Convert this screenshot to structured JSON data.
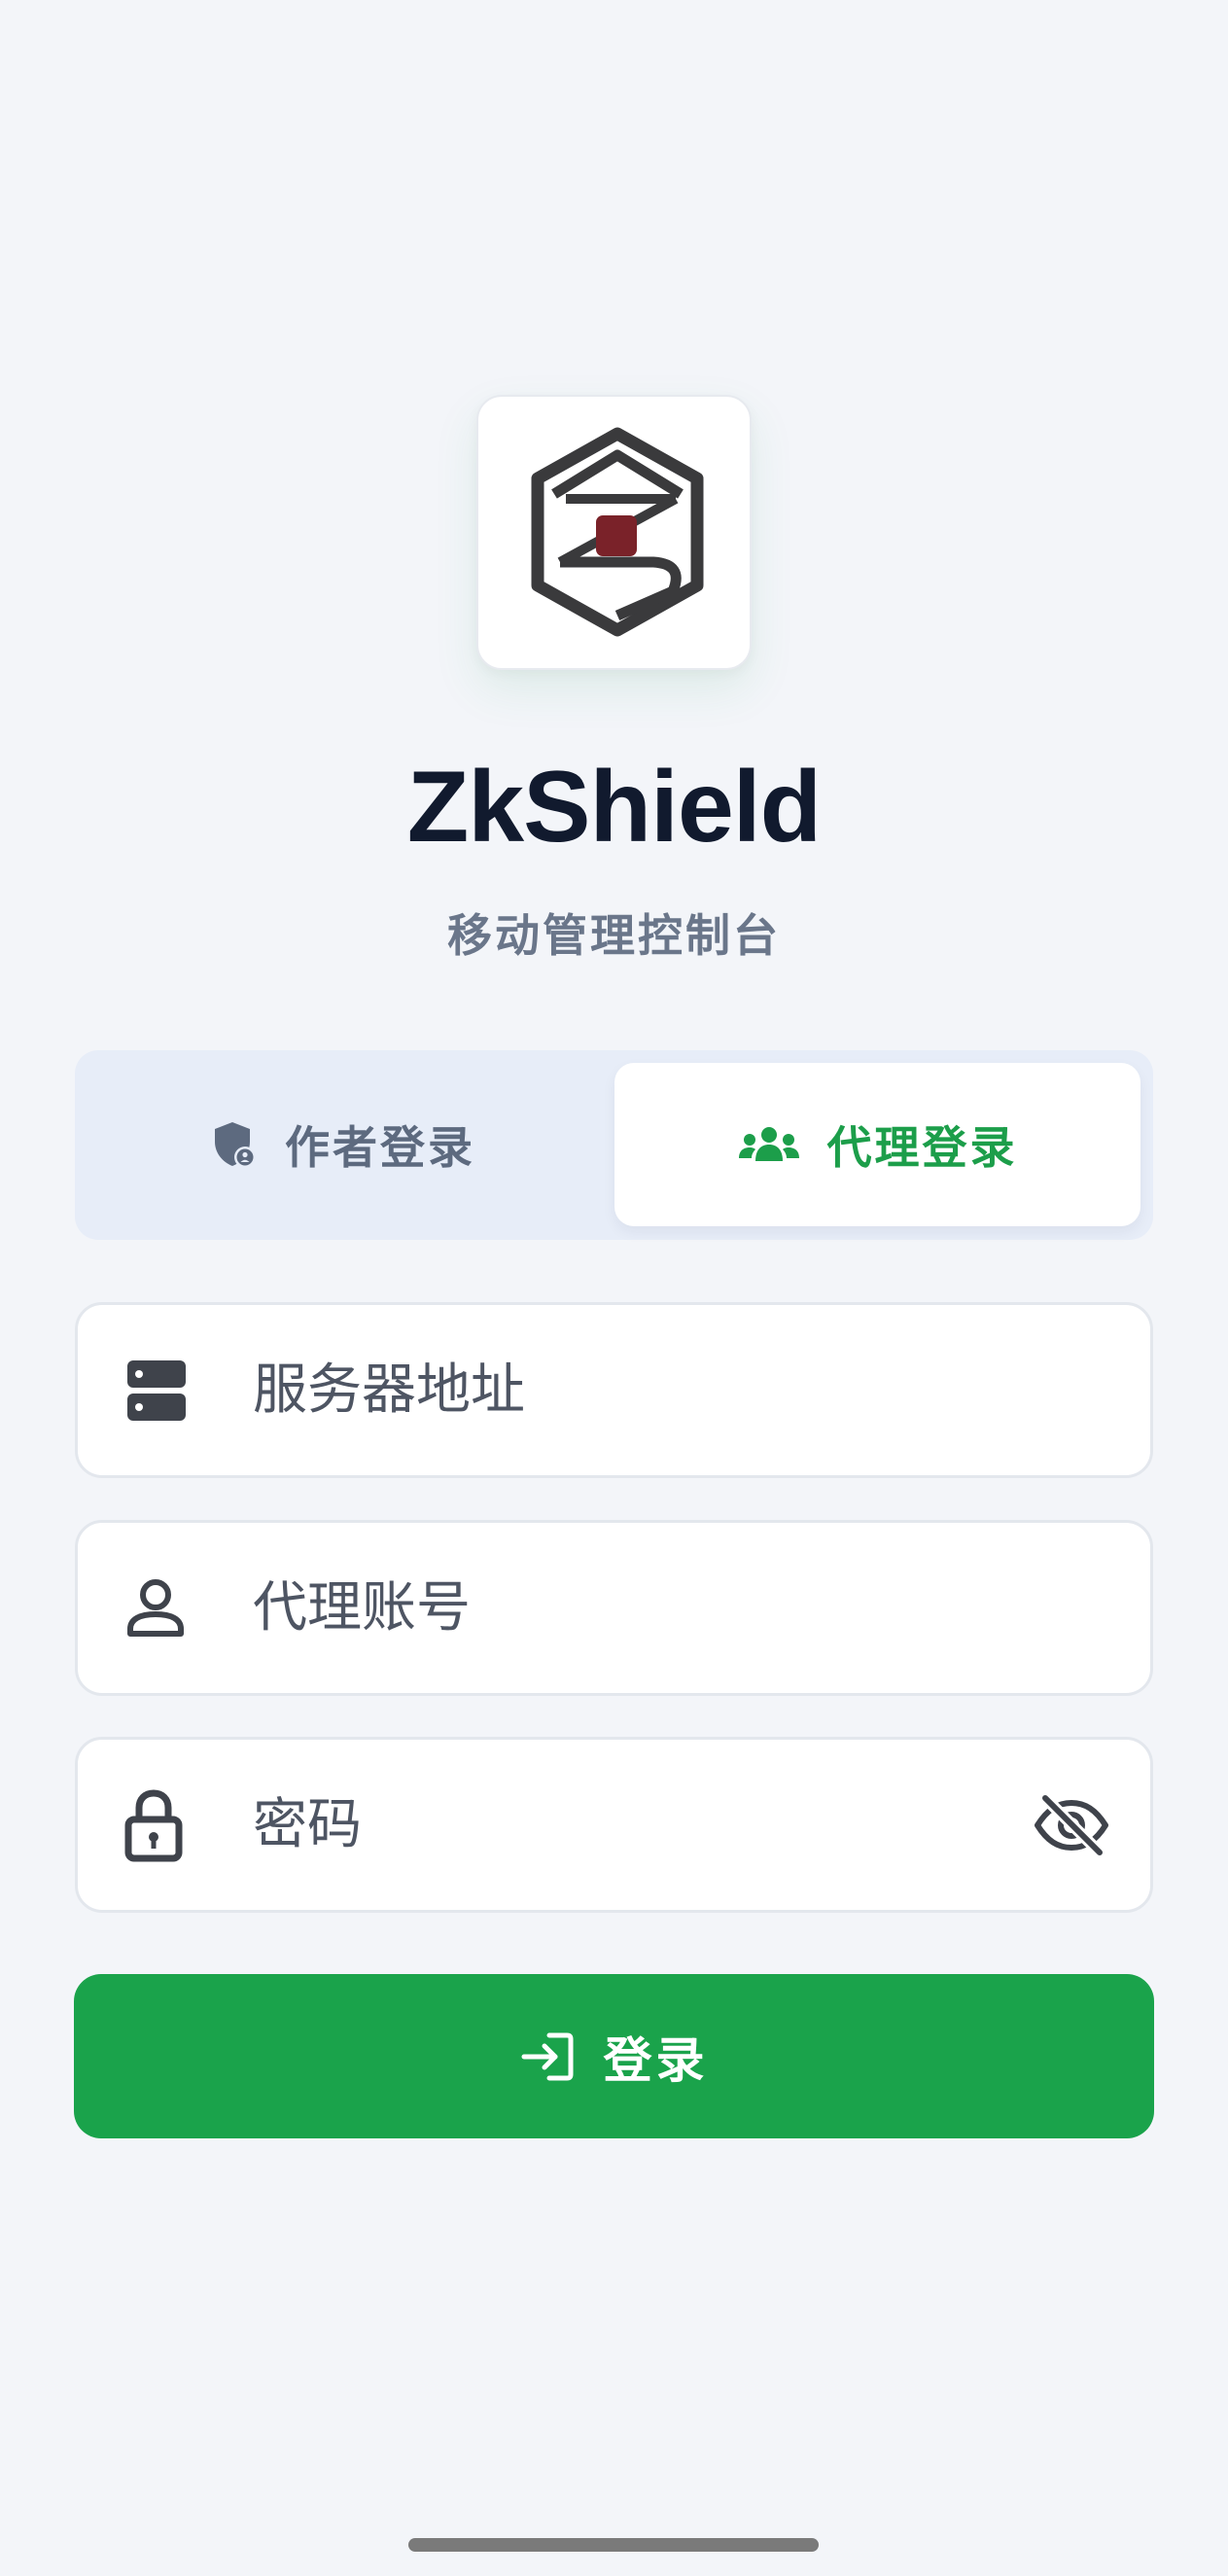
{
  "app": {
    "title": "ZkShield",
    "subtitle": "移动管理控制台",
    "logo_icon": "zkshield-hexagon-logo"
  },
  "tabs": [
    {
      "label": "作者登录",
      "icon": "shield-user-icon",
      "selected": false
    },
    {
      "label": "代理登录",
      "icon": "users-group-icon",
      "selected": true
    }
  ],
  "form": {
    "server": {
      "placeholder": "服务器地址",
      "value": "",
      "icon": "server-icon"
    },
    "account": {
      "placeholder": "代理账号",
      "value": "",
      "icon": "user-icon"
    },
    "password": {
      "placeholder": "密码",
      "value": "",
      "icon": "lock-icon",
      "toggle_icon": "eye-off-icon"
    }
  },
  "login_button": {
    "label": "登录",
    "icon": "login-arrow-icon"
  },
  "colors": {
    "brand_green": "#1aa34b",
    "title": "#111a2e",
    "subtitle": "#6a768a",
    "background": "#f3f5f9",
    "logo_accent": "#7a2229"
  }
}
